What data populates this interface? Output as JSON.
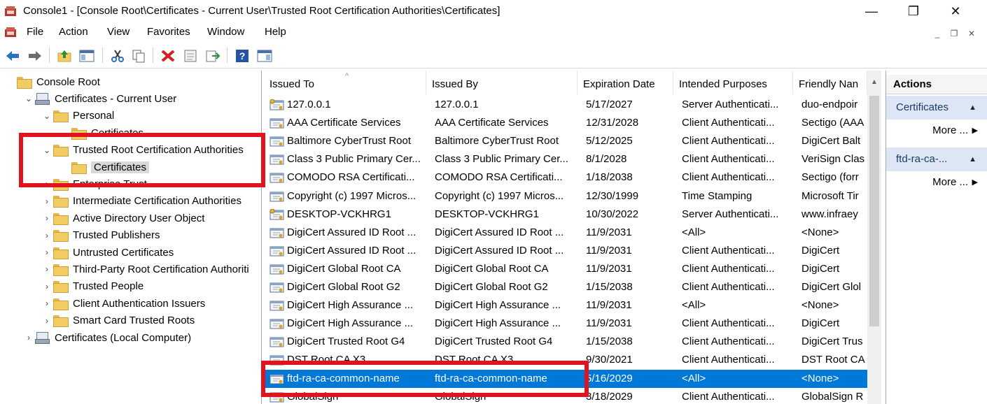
{
  "window": {
    "title": "Console1 - [Console Root\\Certificates - Current User\\Trusted Root Certification Authorities\\Certificates]",
    "minimize_glyph": "—",
    "maximize_glyph": "❐",
    "close_glyph": "✕"
  },
  "menu": {
    "items": [
      "File",
      "Action",
      "View",
      "Favorites",
      "Window",
      "Help"
    ],
    "mdi_controls": [
      "_",
      "❐",
      "✕"
    ]
  },
  "toolbar": {
    "icons": [
      "back-icon",
      "forward-icon",
      "up-folder-icon",
      "show-hide-tree-icon",
      "cut-icon",
      "copy-icon",
      "delete-icon",
      "properties-icon",
      "export-list-icon",
      "help-icon",
      "show-hide-action-pane-icon"
    ]
  },
  "tree": [
    {
      "label": "Console Root",
      "icon": "folder",
      "chev": "",
      "indent": 0
    },
    {
      "label": "Certificates - Current User",
      "icon": "cert-store",
      "chev": "⌄",
      "indent": 1
    },
    {
      "label": "Personal",
      "icon": "folder",
      "chev": "⌄",
      "indent": 2
    },
    {
      "label": "Certificates",
      "icon": "folder",
      "chev": "",
      "indent": 3
    },
    {
      "label": "Trusted Root Certification Authorities",
      "icon": "folder",
      "chev": "⌄",
      "indent": 2
    },
    {
      "label": "Certificates",
      "icon": "folder",
      "chev": "",
      "indent": 3,
      "selected": true
    },
    {
      "label": "Enterprise Trust",
      "icon": "folder",
      "chev": "›",
      "indent": 2
    },
    {
      "label": "Intermediate Certification Authorities",
      "icon": "folder",
      "chev": "›",
      "indent": 2
    },
    {
      "label": "Active Directory User Object",
      "icon": "folder",
      "chev": "›",
      "indent": 2
    },
    {
      "label": "Trusted Publishers",
      "icon": "folder",
      "chev": "›",
      "indent": 2
    },
    {
      "label": "Untrusted Certificates",
      "icon": "folder",
      "chev": "›",
      "indent": 2
    },
    {
      "label": "Third-Party Root Certification Authoriti",
      "icon": "folder",
      "chev": "›",
      "indent": 2
    },
    {
      "label": "Trusted People",
      "icon": "folder",
      "chev": "›",
      "indent": 2
    },
    {
      "label": "Client Authentication Issuers",
      "icon": "folder",
      "chev": "›",
      "indent": 2
    },
    {
      "label": "Smart Card Trusted Roots",
      "icon": "folder",
      "chev": "›",
      "indent": 2
    },
    {
      "label": "Certificates (Local Computer)",
      "icon": "cert-store",
      "chev": "›",
      "indent": 1
    }
  ],
  "list": {
    "columns": [
      "Issued To",
      "Issued By",
      "Expiration Date",
      "Intended Purposes",
      "Friendly Nan"
    ],
    "sort_arrow": "^",
    "rows": [
      {
        "issued_to": "127.0.0.1",
        "issued_by": "127.0.0.1",
        "expiration": "5/17/2027",
        "purposes": "Server Authenticati...",
        "friendly": "duo-endpoir",
        "key_icon": true
      },
      {
        "issued_to": "AAA Certificate Services",
        "issued_by": "AAA Certificate Services",
        "expiration": "12/31/2028",
        "purposes": "Client Authenticati...",
        "friendly": "Sectigo (AAA"
      },
      {
        "issued_to": "Baltimore CyberTrust Root",
        "issued_by": "Baltimore CyberTrust Root",
        "expiration": "5/12/2025",
        "purposes": "Client Authenticati...",
        "friendly": "DigiCert Balt"
      },
      {
        "issued_to": "Class 3 Public Primary Cer...",
        "issued_by": "Class 3 Public Primary Cer...",
        "expiration": "8/1/2028",
        "purposes": "Client Authenticati...",
        "friendly": "VeriSign Clas"
      },
      {
        "issued_to": "COMODO RSA Certificati...",
        "issued_by": "COMODO RSA Certificati...",
        "expiration": "1/18/2038",
        "purposes": "Client Authenticati...",
        "friendly": "Sectigo (forr"
      },
      {
        "issued_to": "Copyright (c) 1997 Micros...",
        "issued_by": "Copyright (c) 1997 Micros...",
        "expiration": "12/30/1999",
        "purposes": "Time Stamping",
        "friendly": "Microsoft Tir"
      },
      {
        "issued_to": "DESKTOP-VCKHRG1",
        "issued_by": "DESKTOP-VCKHRG1",
        "expiration": "10/30/2022",
        "purposes": "Server Authenticati...",
        "friendly": "www.infraey",
        "key_icon": true
      },
      {
        "issued_to": "DigiCert Assured ID Root ...",
        "issued_by": "DigiCert Assured ID Root ...",
        "expiration": "11/9/2031",
        "purposes": "<All>",
        "friendly": "<None>"
      },
      {
        "issued_to": "DigiCert Assured ID Root ...",
        "issued_by": "DigiCert Assured ID Root ...",
        "expiration": "11/9/2031",
        "purposes": "Client Authenticati...",
        "friendly": "DigiCert"
      },
      {
        "issued_to": "DigiCert Global Root CA",
        "issued_by": "DigiCert Global Root CA",
        "expiration": "11/9/2031",
        "purposes": "Client Authenticati...",
        "friendly": "DigiCert"
      },
      {
        "issued_to": "DigiCert Global Root G2",
        "issued_by": "DigiCert Global Root G2",
        "expiration": "1/15/2038",
        "purposes": "Client Authenticati...",
        "friendly": "DigiCert Glol"
      },
      {
        "issued_to": "DigiCert High Assurance ...",
        "issued_by": "DigiCert High Assurance ...",
        "expiration": "11/9/2031",
        "purposes": "<All>",
        "friendly": "<None>"
      },
      {
        "issued_to": "DigiCert High Assurance ...",
        "issued_by": "DigiCert High Assurance ...",
        "expiration": "11/9/2031",
        "purposes": "Client Authenticati...",
        "friendly": "DigiCert"
      },
      {
        "issued_to": "DigiCert Trusted Root G4",
        "issued_by": "DigiCert Trusted Root G4",
        "expiration": "1/15/2038",
        "purposes": "Client Authenticati...",
        "friendly": "DigiCert Trus"
      },
      {
        "issued_to": "DST Root CA X3",
        "issued_by": "DST Root CA X3",
        "expiration": "9/30/2021",
        "purposes": "Client Authenticati...",
        "friendly": "DST Root CA"
      },
      {
        "issued_to": "ftd-ra-ca-common-name",
        "issued_by": "ftd-ra-ca-common-name",
        "expiration": "5/16/2029",
        "purposes": "<All>",
        "friendly": "<None>",
        "selected": true
      },
      {
        "issued_to": "GlobalSign",
        "issued_by": "GlobalSign",
        "expiration": "3/18/2029",
        "purposes": "Client Authenticati...",
        "friendly": "GlobalSign R"
      }
    ]
  },
  "actions": {
    "title": "Actions",
    "groups": [
      {
        "label": "Certificates",
        "collapse_glyph": "▲",
        "more_label": "More ...",
        "more_glyph": "▶"
      },
      {
        "label": "ftd-ra-ca-...",
        "collapse_glyph": "▲",
        "more_label": "More ...",
        "more_glyph": "▶"
      }
    ]
  },
  "colors": {
    "selection": "#0078d7",
    "highlight_box": "#e0141f",
    "folder": "#f3cb63",
    "action_group_bg": "#dce6f4"
  }
}
